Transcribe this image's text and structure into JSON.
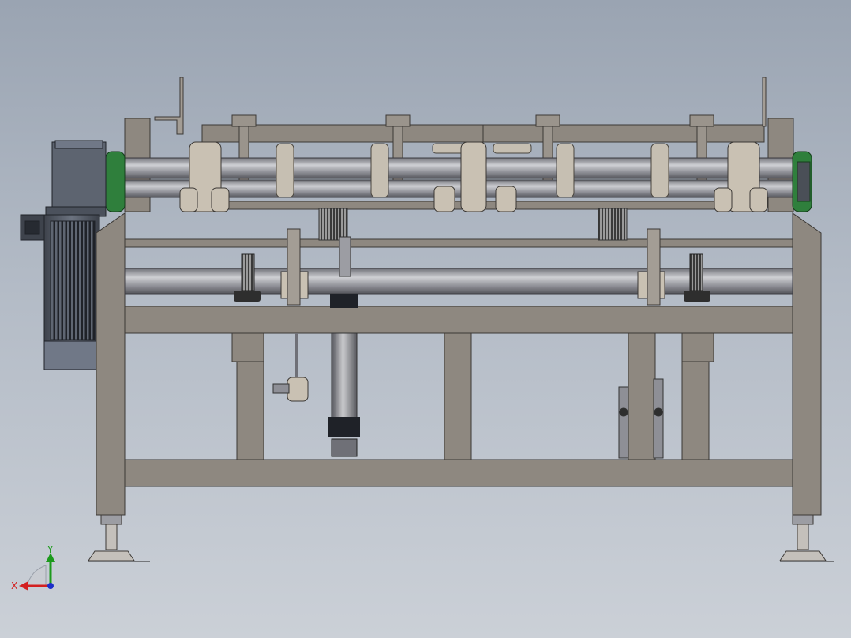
{
  "viewport": {
    "view_orientation": "front",
    "background_top": "#9aa4b2",
    "background_bottom": "#cbd0d7"
  },
  "colors": {
    "frame": "#8e8880",
    "frame_edge": "#3b3835",
    "roller": "#9c9da3",
    "roller_highlight": "#c9cacd",
    "motor": "#5d6470",
    "motor_dark": "#2c3038",
    "coupling_green": "#2f7f3c",
    "bearing": "#c9c1b3",
    "spring": "#444444",
    "foot": "#c4c0bb"
  },
  "triad": {
    "x_label": "X",
    "y_label": "Y",
    "x_color": "#d32020",
    "y_color": "#1c9a1c",
    "z_color": "#1d2fc9"
  }
}
